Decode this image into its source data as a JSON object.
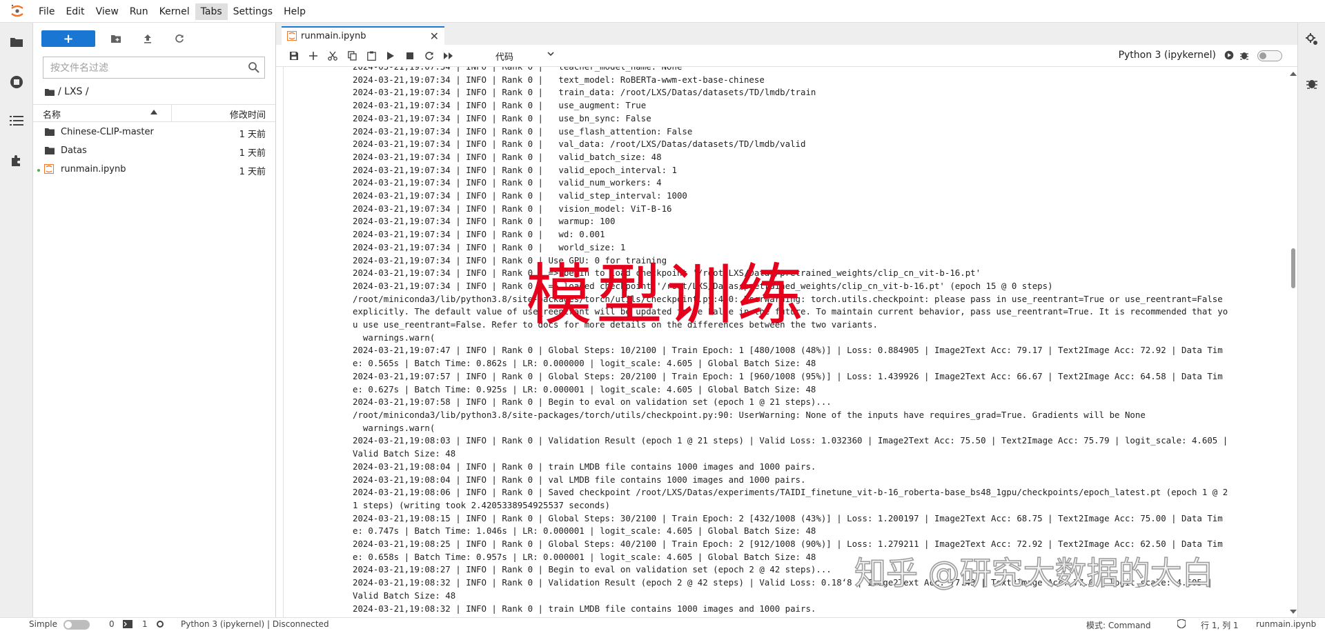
{
  "menu": [
    "File",
    "Edit",
    "View",
    "Run",
    "Kernel",
    "Tabs",
    "Settings",
    "Help"
  ],
  "filebrowser": {
    "new_label": "+",
    "filter_placeholder": "按文件名过滤",
    "breadcrumb": "/ LXS /",
    "col_name": "名称",
    "col_modified": "修改时间",
    "items": [
      {
        "name": "Chinese-CLIP-master",
        "time": "1 天前",
        "type": "folder"
      },
      {
        "name": "Datas",
        "time": "1 天前",
        "type": "folder"
      },
      {
        "name": "runmain.ipynb",
        "time": "1 天前",
        "type": "notebook"
      }
    ]
  },
  "tab": {
    "title": "runmain.ipynb",
    "close": "✕"
  },
  "toolbar": {
    "cell_type": "代码",
    "kernel": "Python 3 (ipykernel)"
  },
  "output_lines": [
    "2024-03-21,19:07:34 | INFO | Rank 0 |   teacher_model_name: None",
    "2024-03-21,19:07:34 | INFO | Rank 0 |   text_model: RoBERTa-wwm-ext-base-chinese",
    "2024-03-21,19:07:34 | INFO | Rank 0 |   train_data: /root/LXS/Datas/datasets/TD/lmdb/train",
    "2024-03-21,19:07:34 | INFO | Rank 0 |   use_augment: True",
    "2024-03-21,19:07:34 | INFO | Rank 0 |   use_bn_sync: False",
    "2024-03-21,19:07:34 | INFO | Rank 0 |   use_flash_attention: False",
    "2024-03-21,19:07:34 | INFO | Rank 0 |   val_data: /root/LXS/Datas/datasets/TD/lmdb/valid",
    "2024-03-21,19:07:34 | INFO | Rank 0 |   valid_batch_size: 48",
    "2024-03-21,19:07:34 | INFO | Rank 0 |   valid_epoch_interval: 1",
    "2024-03-21,19:07:34 | INFO | Rank 0 |   valid_num_workers: 4",
    "2024-03-21,19:07:34 | INFO | Rank 0 |   valid_step_interval: 1000",
    "2024-03-21,19:07:34 | INFO | Rank 0 |   vision_model: ViT-B-16",
    "2024-03-21,19:07:34 | INFO | Rank 0 |   warmup: 100",
    "2024-03-21,19:07:34 | INFO | Rank 0 |   wd: 0.001",
    "2024-03-21,19:07:34 | INFO | Rank 0 |   world_size: 1",
    "2024-03-21,19:07:34 | INFO | Rank 0 | Use GPU: 0 for training",
    "2024-03-21,19:07:34 | INFO | Rank 0 | => begin to load checkpoint '/root/LXS/Datas/pretrained_weights/clip_cn_vit-b-16.pt'",
    "2024-03-21,19:07:34 | INFO | Rank 0 | => loaded checkpoint '/root/LXS/Datas/pretrained_weights/clip_cn_vit-b-16.pt' (epoch 15 @ 0 steps)",
    "/root/miniconda3/lib/python3.8/site-packages/torch/utils/checkpoint.py:460: UserWarning: torch.utils.checkpoint: please pass in use_reentrant=True or use_reentrant=False",
    "explicitly. The default value of use_reentrant will be updated to be False in the future. To maintain current behavior, pass use_reentrant=True. It is recommended that yo",
    "u use use_reentrant=False. Refer to docs for more details on the differences between the two variants.",
    "  warnings.warn(",
    "2024-03-21,19:07:47 | INFO | Rank 0 | Global Steps: 10/2100 | Train Epoch: 1 [480/1008 (48%)] | Loss: 0.884905 | Image2Text Acc: 79.17 | Text2Image Acc: 72.92 | Data Tim",
    "e: 0.565s | Batch Time: 0.862s | LR: 0.000000 | logit_scale: 4.605 | Global Batch Size: 48",
    "2024-03-21,19:07:57 | INFO | Rank 0 | Global Steps: 20/2100 | Train Epoch: 1 [960/1008 (95%)] | Loss: 1.439926 | Image2Text Acc: 66.67 | Text2Image Acc: 64.58 | Data Tim",
    "e: 0.627s | Batch Time: 0.925s | LR: 0.000001 | logit_scale: 4.605 | Global Batch Size: 48",
    "2024-03-21,19:07:58 | INFO | Rank 0 | Begin to eval on validation set (epoch 1 @ 21 steps)...",
    "/root/miniconda3/lib/python3.8/site-packages/torch/utils/checkpoint.py:90: UserWarning: None of the inputs have requires_grad=True. Gradients will be None",
    "  warnings.warn(",
    "2024-03-21,19:08:03 | INFO | Rank 0 | Validation Result (epoch 1 @ 21 steps) | Valid Loss: 1.032360 | Image2Text Acc: 75.50 | Text2Image Acc: 75.79 | logit_scale: 4.605 |",
    "Valid Batch Size: 48",
    "2024-03-21,19:08:04 | INFO | Rank 0 | train LMDB file contains 1000 images and 1000 pairs.",
    "2024-03-21,19:08:04 | INFO | Rank 0 | val LMDB file contains 1000 images and 1000 pairs.",
    "2024-03-21,19:08:06 | INFO | Rank 0 | Saved checkpoint /root/LXS/Datas/experiments/TAIDI_finetune_vit-b-16_roberta-base_bs48_1gpu/checkpoints/epoch_latest.pt (epoch 1 @ 2",
    "1 steps) (writing took 2.4205338954925537 seconds)",
    "2024-03-21,19:08:15 | INFO | Rank 0 | Global Steps: 30/2100 | Train Epoch: 2 [432/1008 (43%)] | Loss: 1.200197 | Image2Text Acc: 68.75 | Text2Image Acc: 75.00 | Data Tim",
    "e: 0.747s | Batch Time: 1.046s | LR: 0.000001 | logit_scale: 4.605 | Global Batch Size: 48",
    "2024-03-21,19:08:25 | INFO | Rank 0 | Global Steps: 40/2100 | Train Epoch: 2 [912/1008 (90%)] | Loss: 1.279211 | Image2Text Acc: 72.92 | Text2Image Acc: 62.50 | Data Tim",
    "e: 0.658s | Batch Time: 0.957s | LR: 0.000001 | logit_scale: 4.605 | Global Batch Size: 48",
    "2024-03-21,19:08:27 | INFO | Rank 0 | Begin to eval on validation set (epoch 2 @ 42 steps)...",
    "2024-03-21,19:08:32 | INFO | Rank 0 | Validation Result (epoch 2 @ 42 steps) | Valid Loss: 0.18ʻ8 | Image2Text Acc: 77.43 | Text2Image Acc: 77.0 | logit_scale: 4.605 |",
    "Valid Batch Size: 48",
    "2024-03-21,19:08:32 | INFO | Rank 0 | train LMDB file contains 1000 images and 1000 pairs."
  ],
  "overlay": {
    "title": "模型训练",
    "watermark": "知乎 @研究大数据的大白"
  },
  "status": {
    "mode": "Simple",
    "count1": "0",
    "count2": "1",
    "kernel_status": "Python 3 (ipykernel) | Disconnected",
    "edit_mode": "模式: Command",
    "cursor": "行 1, 列 1",
    "filename": "runmain.ipynb"
  },
  "colors": {
    "accent": "#1976d2",
    "watermark_red": "#e5001c",
    "notebook_orange": "#f37626"
  }
}
